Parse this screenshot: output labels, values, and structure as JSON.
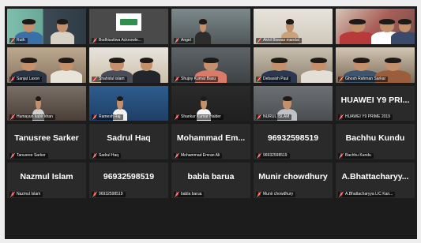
{
  "colors": {
    "grid_background": "#1c1c1c",
    "tile_background": "#2a2a2a",
    "active_speaker_border": "#c6d838",
    "muted_icon": "#e0352b"
  },
  "participants": [
    {
      "label": "Ruth",
      "tile_text": "",
      "video": true,
      "active": false
    },
    {
      "label": "Bodhisattwa Acknowle...",
      "tile_text": "",
      "video": true,
      "active": false
    },
    {
      "label": "Angel",
      "tile_text": "",
      "video": true,
      "active": false
    },
    {
      "label": "Akhil Biswas mandal",
      "tile_text": "",
      "video": true,
      "active": true
    },
    {
      "label": "",
      "tile_text": "",
      "video": true,
      "active": false
    },
    {
      "label": "Sanjat Laxon",
      "tile_text": "",
      "video": true,
      "active": false
    },
    {
      "label": "Shahidul islam",
      "tile_text": "",
      "video": true,
      "active": false
    },
    {
      "label": "Shujoy Kumar Basu",
      "tile_text": "",
      "video": true,
      "active": false
    },
    {
      "label": "Debasish Paul",
      "tile_text": "",
      "video": true,
      "active": false
    },
    {
      "label": "Ghosh Rahman Sarkar",
      "tile_text": "",
      "video": true,
      "active": false
    },
    {
      "label": "Humayun kabir khan",
      "tile_text": "",
      "video": true,
      "active": false
    },
    {
      "label": "Ramesh Raj",
      "tile_text": "",
      "video": true,
      "active": false
    },
    {
      "label": "Shankar Kumar Halder",
      "tile_text": "",
      "video": true,
      "active": false
    },
    {
      "label": "NURUL ISLAM",
      "tile_text": "",
      "video": true,
      "active": false
    },
    {
      "label": "HUAWEI Y9 PRIME 2019",
      "tile_text": "HUAWEI Y9 PRI...",
      "video": false,
      "active": false
    },
    {
      "label": "Tanusree Sarker",
      "tile_text": "Tanusree Sarker",
      "video": false,
      "active": false
    },
    {
      "label": "Sadrul Haq",
      "tile_text": "Sadrul Haq",
      "video": false,
      "active": false
    },
    {
      "label": "Mohammad Emran Ali",
      "tile_text": "Mohammad Em...",
      "video": false,
      "active": false
    },
    {
      "label": "96932598519",
      "tile_text": "96932598519",
      "video": false,
      "active": false
    },
    {
      "label": "Bachhu Kundu",
      "tile_text": "Bachhu Kundu",
      "video": false,
      "active": false
    },
    {
      "label": "Nazmul Islam",
      "tile_text": "Nazmul Islam",
      "video": false,
      "active": false
    },
    {
      "label": "96932598519",
      "tile_text": "96932598519",
      "video": false,
      "active": false
    },
    {
      "label": "babla barua",
      "tile_text": "babla barua",
      "video": false,
      "active": false
    },
    {
      "label": "Munir chowdhury",
      "tile_text": "Munir chowdhury",
      "video": false,
      "active": false
    },
    {
      "label": "A.Bhattacharyya LIC Kan...",
      "tile_text": "A.Bhattacharyy...",
      "video": false,
      "active": false
    }
  ]
}
